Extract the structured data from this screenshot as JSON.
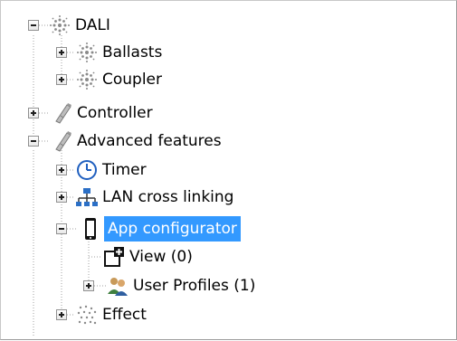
{
  "tree": {
    "items": [
      {
        "label": "DALI",
        "icon": "dali-sparkle-icon",
        "expanded": true
      },
      {
        "label": "Ballasts",
        "icon": "dali-sparkle-icon",
        "expanded": false
      },
      {
        "label": "Coupler",
        "icon": "dali-sparkle-icon",
        "expanded": false
      },
      {
        "label": "Controller",
        "icon": "controller-pen-icon",
        "expanded": false
      },
      {
        "label": "Advanced features",
        "icon": "controller-pen-icon",
        "expanded": true
      },
      {
        "label": "Timer",
        "icon": "clock-icon",
        "expanded": false
      },
      {
        "label": "LAN cross linking",
        "icon": "network-icon",
        "expanded": false
      },
      {
        "label": "App configurator",
        "icon": "smartphone-icon",
        "expanded": true,
        "selected": true
      },
      {
        "label": "View (0)",
        "icon": "view-add-icon"
      },
      {
        "label": "User Profiles (1)",
        "icon": "users-icon",
        "expanded": false
      },
      {
        "label": "Effect",
        "icon": "effect-dots-icon",
        "expanded": false
      }
    ]
  },
  "colors": {
    "selection": "#3399ff",
    "tree_lines": "#a0a0a0",
    "dali_icon": "#8a8a8a",
    "clock_icon": "#1f5fbf",
    "network_icon": "#2b6fc6"
  }
}
